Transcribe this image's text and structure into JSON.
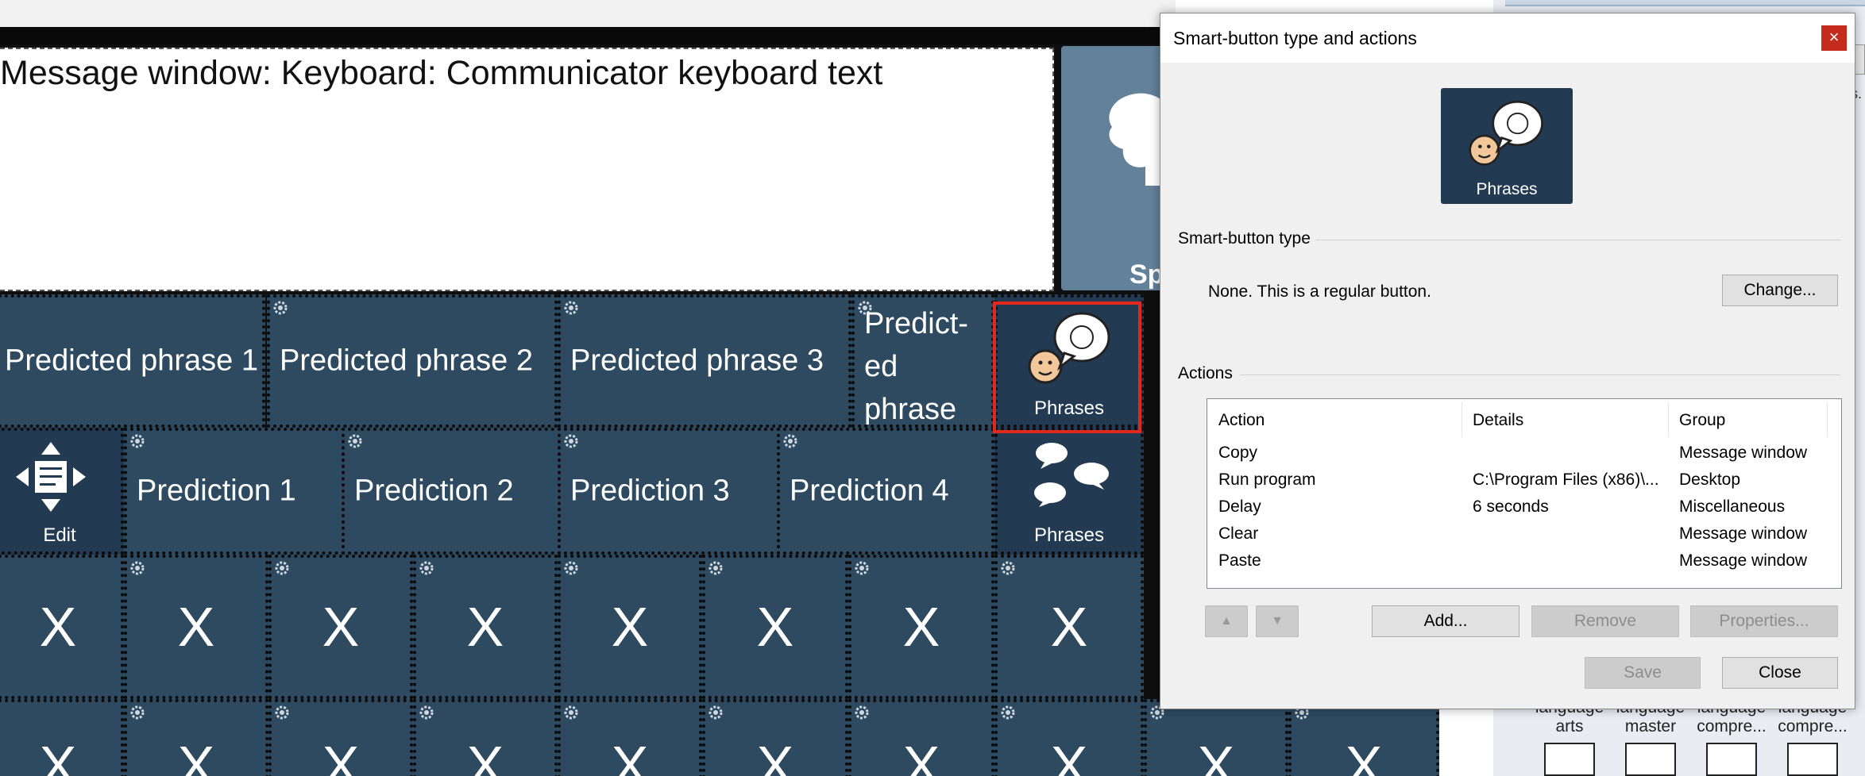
{
  "message_window": {
    "text": "Message window: Keyboard: Communicator keyboard text"
  },
  "speak_tile": {
    "label": "Sp"
  },
  "row_phrases": [
    {
      "label": "Predicted phrase 1"
    },
    {
      "label": "Predicted phrase 2"
    },
    {
      "label": "Predicted phrase 3"
    },
    {
      "label": "Predict-\ned\nphrase"
    }
  ],
  "phrases_selected": {
    "label": "Phrases"
  },
  "edit_tile": {
    "label": "Edit"
  },
  "row_predictions": [
    {
      "label": "Prediction 1"
    },
    {
      "label": "Prediction 2"
    },
    {
      "label": "Prediction 3"
    },
    {
      "label": "Prediction 4"
    }
  ],
  "phrases_tile": {
    "label": "Phrases"
  },
  "x_label": "X",
  "right_panel": {
    "cut_text": "s.",
    "thumbnails": [
      {
        "label": "language\narts"
      },
      {
        "label": "language\nmaster"
      },
      {
        "label": "language\ncompre..."
      },
      {
        "label": "language\ncompre..."
      }
    ]
  },
  "dialog": {
    "title": "Smart-button type and actions",
    "close_glyph": "×",
    "preview_label": "Phrases",
    "smart_button_type_heading": "Smart-button type",
    "type_description": "None. This is a regular button.",
    "change_button": "Change...",
    "actions_heading": "Actions",
    "columns": [
      "Action",
      "Details",
      "Group"
    ],
    "rows": [
      {
        "action": "Copy",
        "details": "",
        "group": "Message window"
      },
      {
        "action": "Run program",
        "details": "C:\\Program Files (x86)\\...",
        "group": "Desktop"
      },
      {
        "action": "Delay",
        "details": "6 seconds",
        "group": "Miscellaneous"
      },
      {
        "action": "Clear",
        "details": "",
        "group": "Message window"
      },
      {
        "action": "Paste",
        "details": "",
        "group": "Message window"
      }
    ],
    "move_up_glyph": "▲",
    "move_down_glyph": "▼",
    "add_button": "Add...",
    "remove_button": "Remove",
    "properties_button": "Properties...",
    "save_button": "Save",
    "close_button": "Close"
  },
  "colors": {
    "tile": "#2e4a60",
    "tile_dark": "#223a52",
    "speak_tile": "#63829a",
    "selection": "#e0281d",
    "dialog_close": "#c42b1c"
  }
}
